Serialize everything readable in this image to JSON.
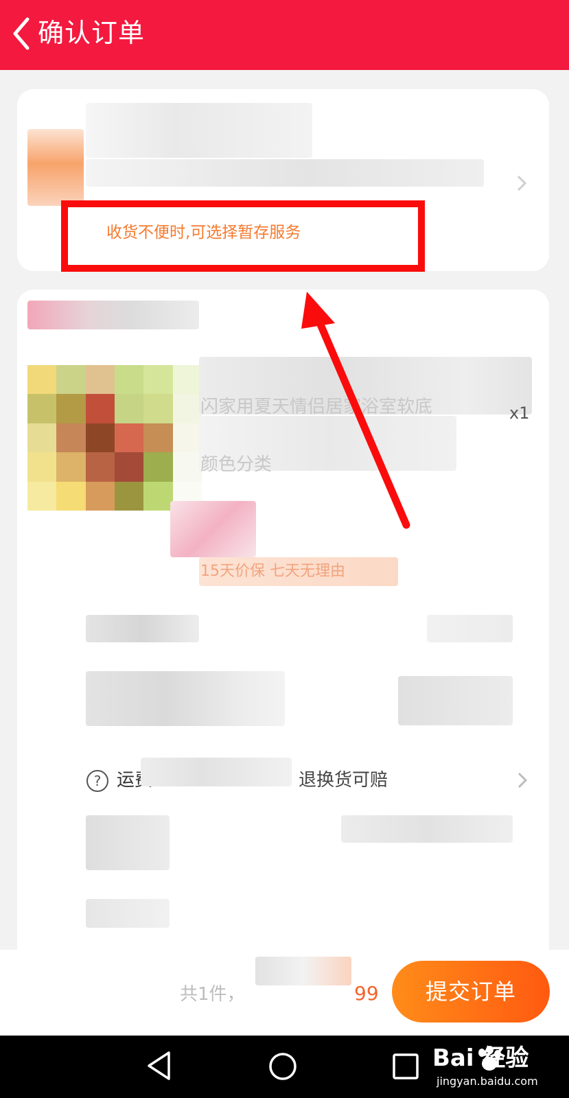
{
  "header": {
    "title": "确认订单",
    "background": "#f3193f"
  },
  "address_card": {
    "storage_hint": "收货不便时,可选择暂存服务"
  },
  "product_card": {
    "item": {
      "quantity": "x1"
    },
    "faint": {
      "name_fragment": "闪家用夏天情侣居家浴室软底",
      "spec_fragment": "颜色分类",
      "service_tags": "15天价保   七天无理由"
    },
    "freight_insurance": {
      "label": "运费",
      "description": "退换货可赔"
    }
  },
  "bottom_bar": {
    "total_prefix": "共1件，",
    "price_tail": "99",
    "submit_label": "提交订单"
  },
  "watermark": {
    "logo_text": "Bai  经验",
    "site": "jingyan.baidu.com"
  },
  "colors": {
    "hint_text": "#f57a2e",
    "highlight_box": "#fb0c0c",
    "submit_start": "#ff8c1a",
    "submit_end": "#ff5a10"
  },
  "icons": {
    "back": "chevron-left-icon",
    "help": "question-circle-icon",
    "nav_back": "triangle-back-icon",
    "nav_home": "circle-home-icon",
    "nav_recent": "square-recent-icon"
  }
}
